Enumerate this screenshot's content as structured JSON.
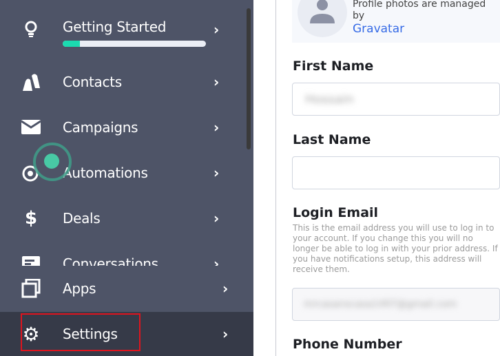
{
  "sidebar": {
    "items": [
      {
        "label": "Getting Started",
        "icon": "lightbulb-icon",
        "progress": 0.12
      },
      {
        "label": "Contacts",
        "icon": "contacts-icon"
      },
      {
        "label": "Campaigns",
        "icon": "envelope-icon"
      },
      {
        "label": "Automations",
        "icon": "automation-gear-icon"
      },
      {
        "label": "Deals",
        "icon": "dollar-icon"
      },
      {
        "label": "Conversations",
        "icon": "chat-icon"
      }
    ],
    "apps": {
      "label": "Apps",
      "icon": "apps-icon"
    },
    "settings": {
      "label": "Settings",
      "icon": "gear-icon"
    },
    "chevron": "›"
  },
  "main": {
    "profile_text": "Profile photos are managed by",
    "gravatar_link": "Gravatar",
    "first_name_label": "First Name",
    "first_name_value": "Hossain",
    "last_name_label": "Last Name",
    "last_name_value": "",
    "login_email_label": "Login Email",
    "login_email_help": [
      "This is the email address you will use to log in to",
      "your account. If you change this you will no longer",
      "be able to log in with your prior address. If you have",
      "notifications setup, this address will receive them."
    ],
    "login_email_value": "mrcasanscasa1497@gmail.com",
    "phone_label": "Phone Number"
  },
  "colors": {
    "sidebar": "#4e5467",
    "active": "#363a48",
    "progress": "#1bdbb0",
    "link": "#356ae6",
    "highlight": "#e0141e"
  }
}
